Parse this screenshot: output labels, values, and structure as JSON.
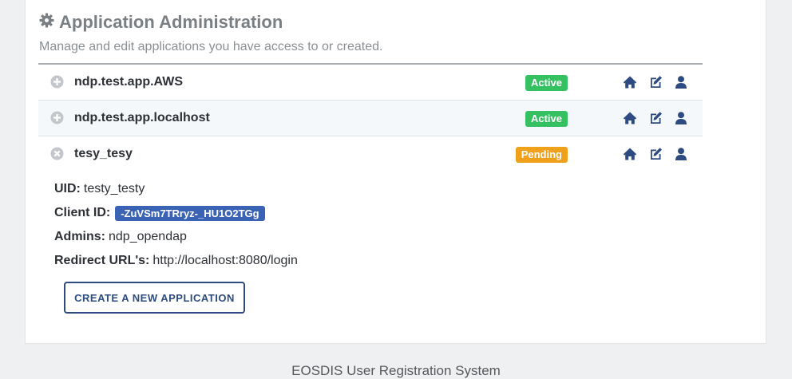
{
  "header": {
    "title": "Application Administration",
    "subtitle": "Manage and edit applications you have access to or created."
  },
  "apps": [
    {
      "name": "ndp.test.app.AWS",
      "status": "Active",
      "status_color": "#35c162",
      "expanded": false,
      "toggle_icon": "plus-circle-icon"
    },
    {
      "name": "ndp.test.app.localhost",
      "status": "Active",
      "status_color": "#35c162",
      "expanded": false,
      "toggle_icon": "plus-circle-icon"
    },
    {
      "name": "tesy_tesy",
      "status": "Pending",
      "status_color": "#f0a11c",
      "expanded": true,
      "toggle_icon": "close-circle-icon",
      "details": {
        "uid_label": "UID:",
        "uid": "testy_testy",
        "client_id_label": "Client ID:",
        "client_id": "-ZuVSm7TRryz-_HU1O2TGg",
        "admins_label": "Admins:",
        "admins": "ndp_opendap",
        "redirect_label": "Redirect URL's:",
        "redirect": "http://localhost:8080/login"
      }
    }
  ],
  "actions": {
    "home_icon": "home-icon",
    "edit_icon": "edit-icon",
    "user_icon": "user-icon",
    "color": "#2d4b80"
  },
  "create_button": {
    "label": "CREATE A NEW APPLICATION"
  },
  "footer": {
    "text": "EOSDIS User Registration System"
  }
}
